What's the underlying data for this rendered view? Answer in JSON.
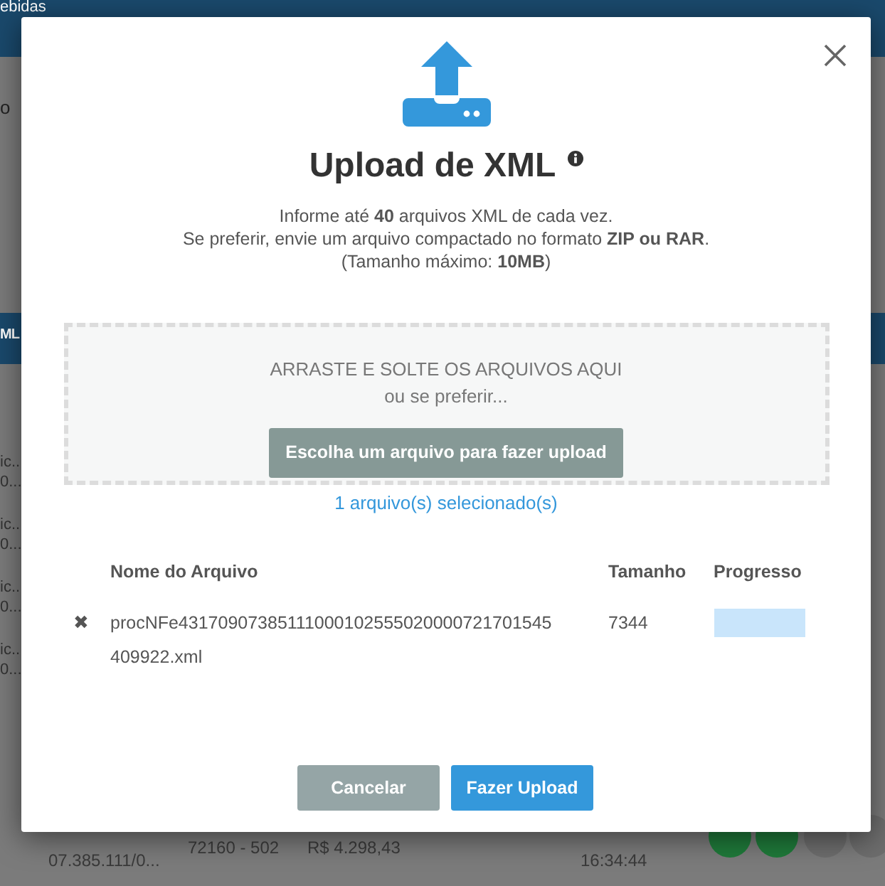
{
  "background": {
    "app_title": "ebidas",
    "left_labels": [
      {
        "text": "o"
      },
      {
        "text": "ML"
      }
    ],
    "left_cells": [
      {
        "line1": "ic..",
        "line2": "0..."
      },
      {
        "line1": "ic..",
        "line2": "0..."
      },
      {
        "line1": "ic..",
        "line2": "0..."
      },
      {
        "line1": "ic..",
        "line2": "0..."
      }
    ],
    "bottom_row": {
      "document": "07.385.111/0...",
      "code": "72160 - 502",
      "value": "R$ 4.298,43",
      "time": "16:34:44"
    }
  },
  "dialog": {
    "title": "Upload de XML",
    "intro": [
      "Informe até **40** arquivos XML de cada vez.",
      "Se preferir, envie um arquivo compactado no formato **ZIP ou RAR**.",
      "(Tamanho máximo: **10MB**)"
    ],
    "dropzone": {
      "text": "ARRASTE E SOLTE OS ARQUIVOS AQUI",
      "subtext": "ou se preferir...",
      "button": "Escolha um arquivo para fazer upload"
    },
    "selected_count": "1 arquivo(s) selecionado(s)",
    "table": {
      "columns": [
        "Nome do Arquivo",
        "Tamanho",
        "Progresso"
      ],
      "rows": [
        {
          "remove": "✖",
          "name": "procNFe43170907385111000102555020000721701545409922.xml",
          "size": "7344",
          "level": 0
        }
      ]
    },
    "buttons": [
      {
        "label": "Cancelar",
        "kind": "secondary"
      },
      {
        "label": "Fazer Upload",
        "kind": "primary"
      }
    ]
  }
}
